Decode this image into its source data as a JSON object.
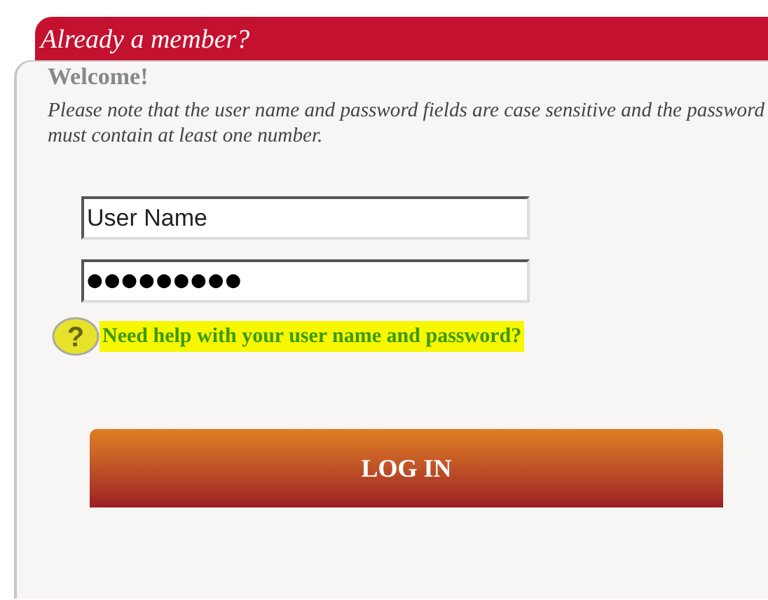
{
  "header": {
    "title": "Already a member?"
  },
  "welcome": "Welcome!",
  "note": "Please note that the user name and password fields are case sensitive and the password must contain at least one number.",
  "fields": [
    {
      "kind": "text",
      "value": "User Name"
    },
    {
      "kind": "password",
      "value": "●●●●●●●●●"
    }
  ],
  "help_link": {
    "icon": "?",
    "label": "Need help with your user name and password?",
    "highlighted": true
  },
  "button": {
    "label": "LOG IN"
  }
}
